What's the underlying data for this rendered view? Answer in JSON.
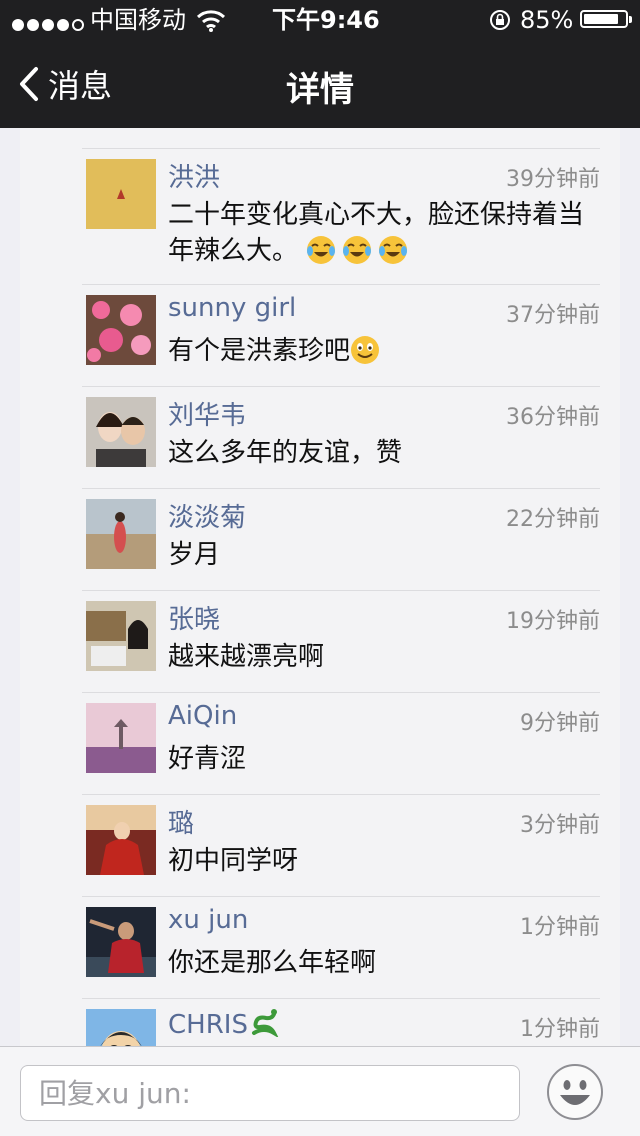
{
  "status_bar": {
    "carrier": "中国移动",
    "time": "下午9:46",
    "battery_text": "85%",
    "battery_level": 0.85,
    "signal_icon": "signal-dots-icon",
    "wifi_icon": "wifi-icon",
    "lock_icon": "rotation-lock-icon"
  },
  "nav": {
    "back_label": "消息",
    "title": "详情"
  },
  "comments": [
    {
      "name": "洪洪",
      "time": "39分钟前",
      "text": "二十年变化真心不大，脸还保持着当年辣么大。",
      "emoji": [
        "joy-tears-emoji",
        "joy-tears-emoji",
        "joy-tears-emoji"
      ]
    },
    {
      "name": "sunny girl",
      "time": "37分钟前",
      "text": "有个是洪素珍吧",
      "emoji": [
        "smile-emoji"
      ]
    },
    {
      "name": "刘华韦",
      "time": "36分钟前",
      "text": "这么多年的友谊，赞"
    },
    {
      "name": "淡淡菊",
      "time": "22分钟前",
      "text": "岁月"
    },
    {
      "name": "张晓",
      "time": "19分钟前",
      "text": "越来越漂亮啊"
    },
    {
      "name": "AiQin",
      "time": "9分钟前",
      "text": "好青涩"
    },
    {
      "name": "璐",
      "time": "3分钟前",
      "text": "初中同学呀"
    },
    {
      "name": "xu jun",
      "time": "1分钟前",
      "text": "你还是那么年轻啊"
    },
    {
      "name": "CHRIS",
      "time": "1分钟前",
      "text": "",
      "name_icon": "snake-icon"
    }
  ],
  "reply": {
    "placeholder": "回复xu jun:",
    "emoji_icon": "smiley-face-icon"
  },
  "colors": {
    "nav_background": "#1f1f21",
    "name_link": "#576b95",
    "timestamp": "#8c8c8c",
    "page_background": "#efeff4"
  }
}
